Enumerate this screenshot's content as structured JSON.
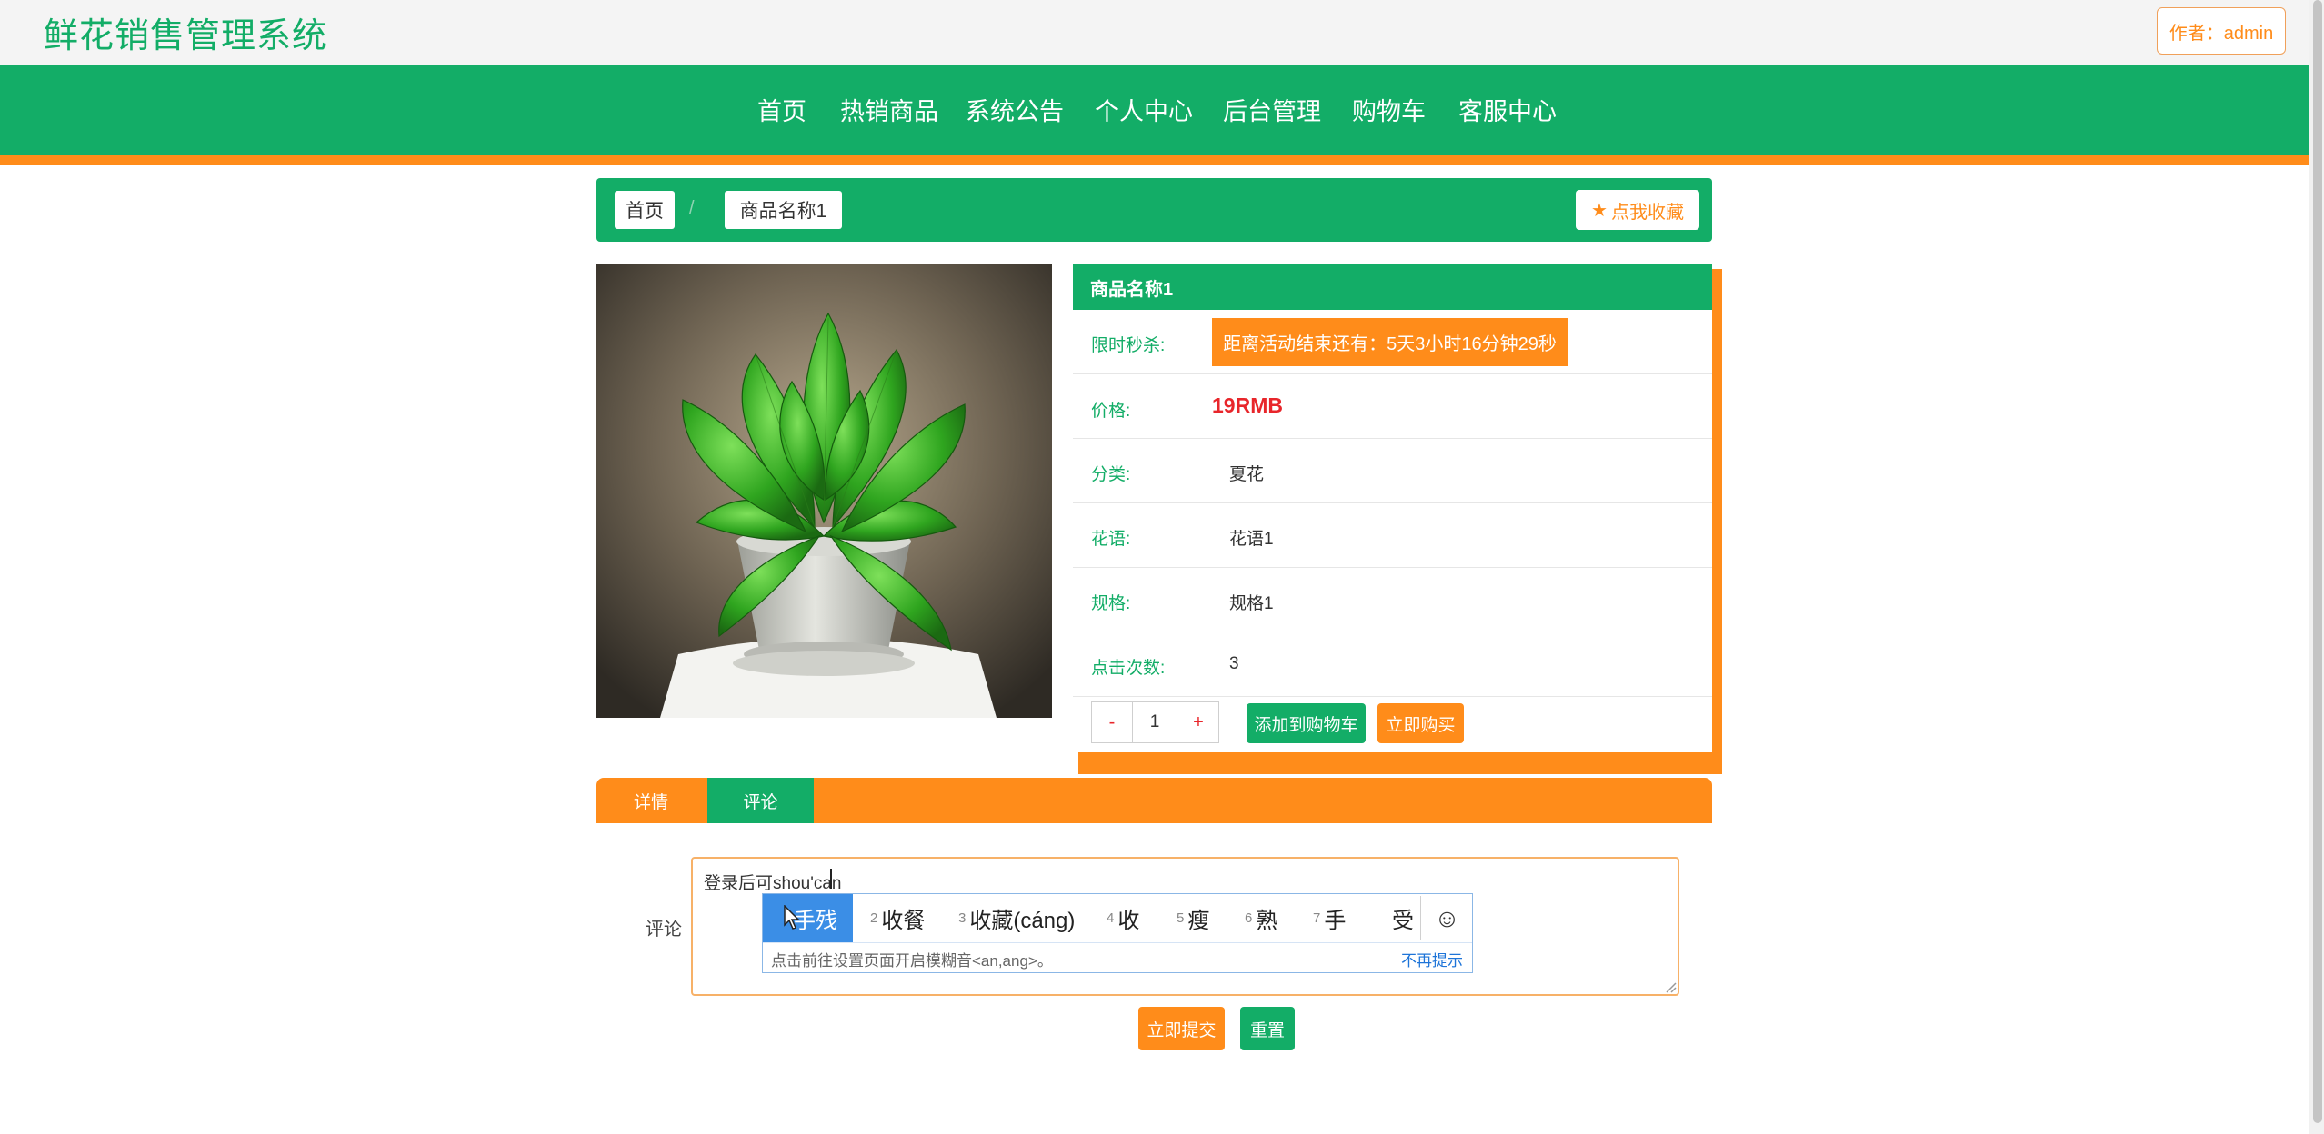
{
  "header": {
    "site_title": "鲜花销售管理系统",
    "author_label": "作者：admin"
  },
  "nav": {
    "items": [
      "首页",
      "热销商品",
      "系统公告",
      "个人中心",
      "后台管理",
      "购物车",
      "客服中心"
    ]
  },
  "breadcrumb": {
    "home": "首页",
    "separator": "/",
    "current": "商品名称1",
    "favorite_label": "点我收藏"
  },
  "product": {
    "name": "商品名称1",
    "flash_sale_label": "限时秒杀:",
    "countdown": "距离活动结束还有：5天3小时16分钟29秒",
    "price_label": "价格:",
    "price": "19RMB",
    "category_label": "分类:",
    "category": "夏花",
    "flower_language_label": "花语:",
    "flower_language": "花语1",
    "spec_label": "规格:",
    "spec": "规格1",
    "clicks_label": "点击次数:",
    "clicks": "3",
    "quantity": "1",
    "minus_label": "-",
    "plus_label": "+",
    "add_to_cart_label": "添加到购物车",
    "buy_now_label": "立即购买"
  },
  "tabs": [
    {
      "label": "详情",
      "active": false
    },
    {
      "label": "评论",
      "active": true
    }
  ],
  "comment_form": {
    "label": "评论",
    "text_prefix": "登录后可",
    "text_pinyin": "shou'can",
    "submit_label": "立即提交",
    "reset_label": "重置"
  },
  "ime": {
    "candidates": [
      {
        "num": "",
        "text": "手残"
      },
      {
        "num": "2",
        "text": "收餐"
      },
      {
        "num": "3",
        "text": "收藏(cáng)"
      },
      {
        "num": "4",
        "text": "收"
      },
      {
        "num": "5",
        "text": "瘦"
      },
      {
        "num": "6",
        "text": "熟"
      },
      {
        "num": "7",
        "text": "手"
      },
      {
        "num": "",
        "text": "受"
      }
    ],
    "tip": "点击前往设置页面开启模糊音<an,ang>。",
    "dismiss": "不再提示",
    "emoji_icon": "☺"
  },
  "colors": {
    "brand_green": "#13ad67",
    "accent_orange": "#ff8c1a",
    "price_red": "#e8262b"
  }
}
